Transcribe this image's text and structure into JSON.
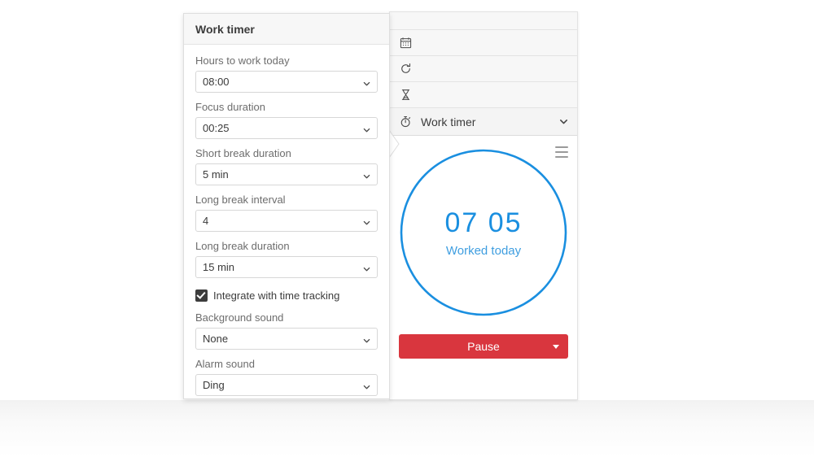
{
  "settings_panel": {
    "title": "Work timer",
    "fields": [
      {
        "label": "Hours to work today",
        "value": "08:00",
        "name": "hours-to-work-today"
      },
      {
        "label": "Focus duration",
        "value": "00:25",
        "name": "focus-duration"
      },
      {
        "label": "Short break duration",
        "value": "5 min",
        "name": "short-break-duration"
      },
      {
        "label": "Long break interval",
        "value": "4",
        "name": "long-break-interval"
      },
      {
        "label": "Long break duration",
        "value": "15 min",
        "name": "long-break-duration"
      }
    ],
    "checkbox": {
      "label": "Integrate with time tracking",
      "checked": true
    },
    "sound_fields": [
      {
        "label": "Background sound",
        "value": "None",
        "name": "background-sound"
      },
      {
        "label": "Alarm sound",
        "value": "Ding",
        "name": "alarm-sound"
      }
    ]
  },
  "widget_column": {
    "rows": [
      {
        "icon": "calendar-icon",
        "label": ""
      },
      {
        "icon": "refresh-icon",
        "label": ""
      },
      {
        "icon": "hourglass-icon",
        "label": ""
      }
    ],
    "active_row": {
      "icon": "stopwatch-icon",
      "label": "Work timer",
      "chevron": "chevron-down-icon"
    }
  },
  "timer": {
    "display": "07 05",
    "caption": "Worked today",
    "ring_color": "#1a8fe0",
    "text_color": "#1a8fe0",
    "caption_color": "#3f9ee0",
    "progress_percent": 100,
    "menu_icon": "hamburger-menu-icon"
  },
  "action": {
    "label": "Pause",
    "color": "#d9363e",
    "dropdown_icon": "caret-down-icon"
  }
}
